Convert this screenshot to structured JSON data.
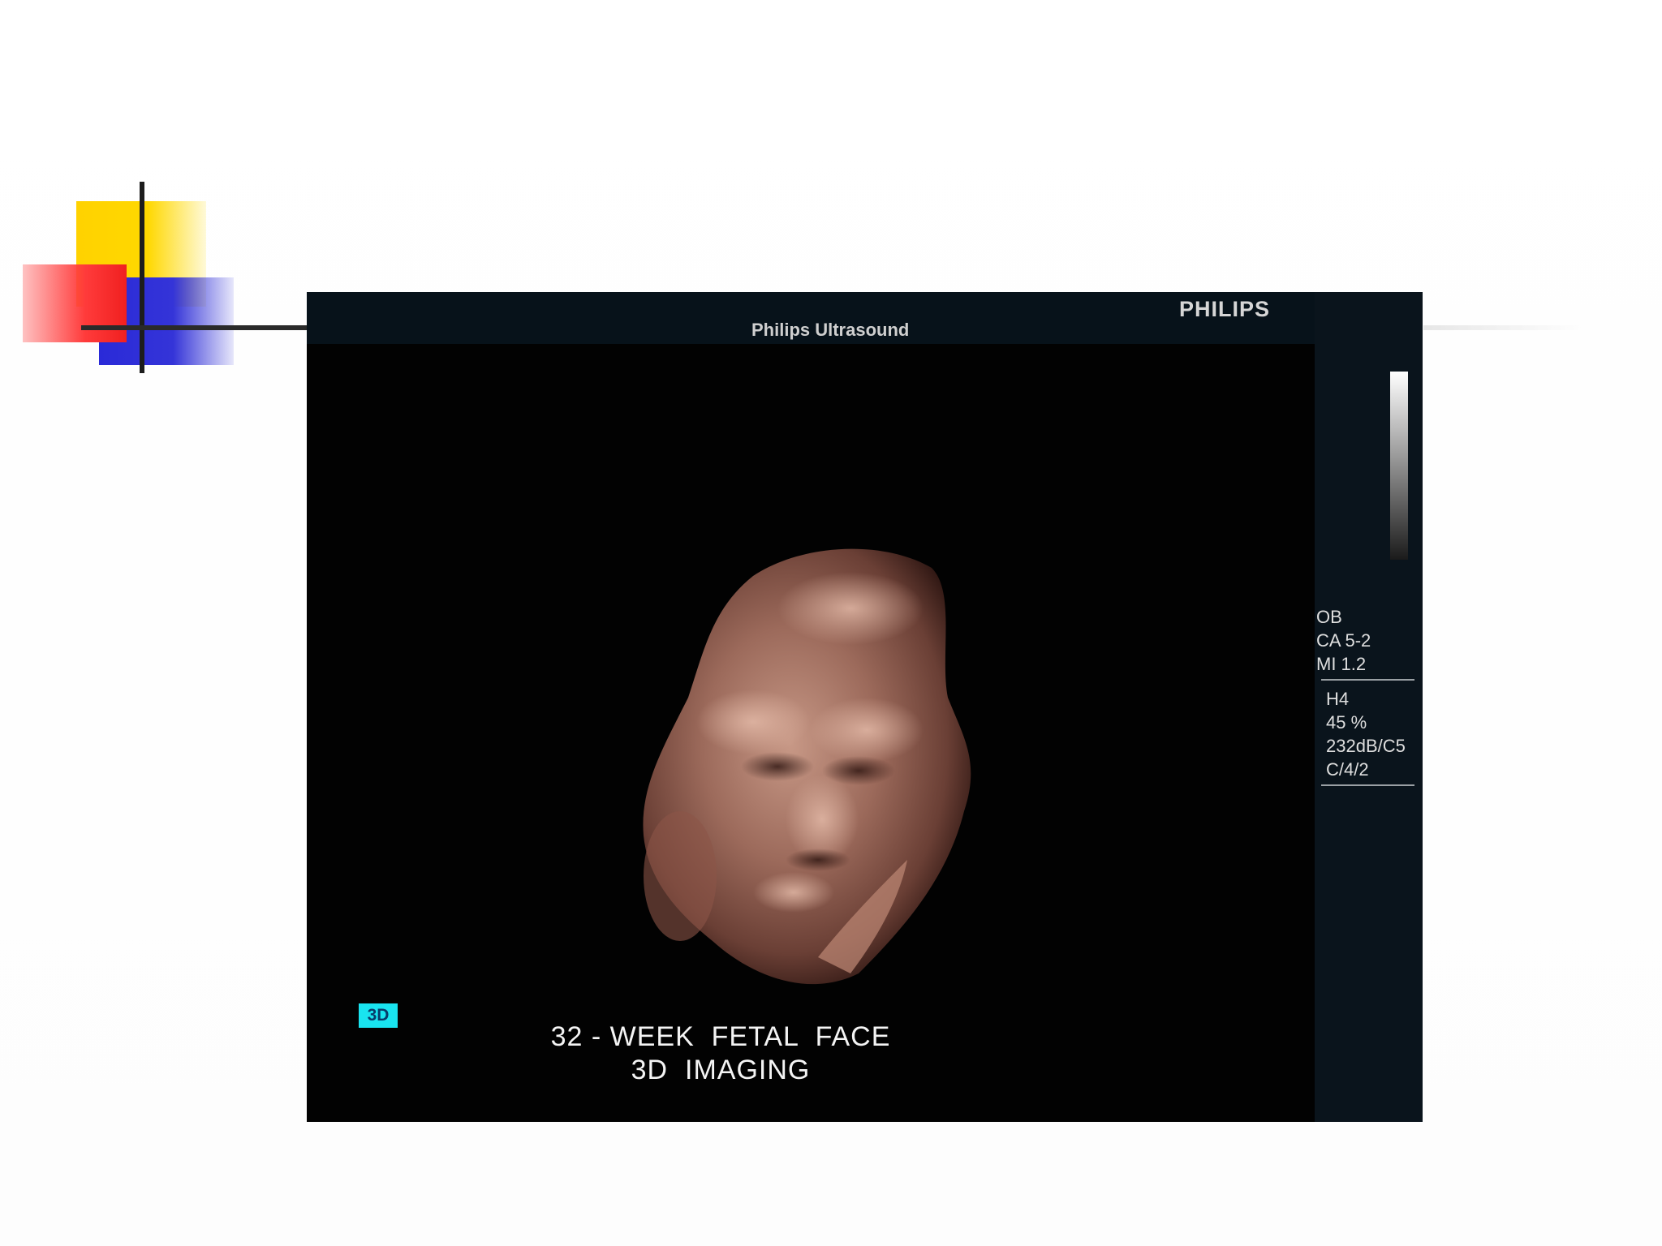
{
  "ultrasound": {
    "brand": "PHILIPS",
    "system_name": "Philips Ultrasound",
    "mode_badge": "3D",
    "caption_line1": "32 - WEEK  FETAL  FACE",
    "caption_line2": "3D  IMAGING",
    "params_group1": [
      "OB",
      "CA 5-2",
      "MI 1.2"
    ],
    "params_group2": [
      "H4",
      "45 %",
      "232dB/C5",
      "C/4/2"
    ]
  },
  "colors": {
    "deco_yellow": "#ffd200",
    "deco_red": "#ff3b3b",
    "deco_blue": "#2a2ad8",
    "badge_cyan": "#19e4f0",
    "tissue": "#8a5a4e"
  },
  "icons": [
    "slide-corner-decoration",
    "grayscale-bar"
  ]
}
